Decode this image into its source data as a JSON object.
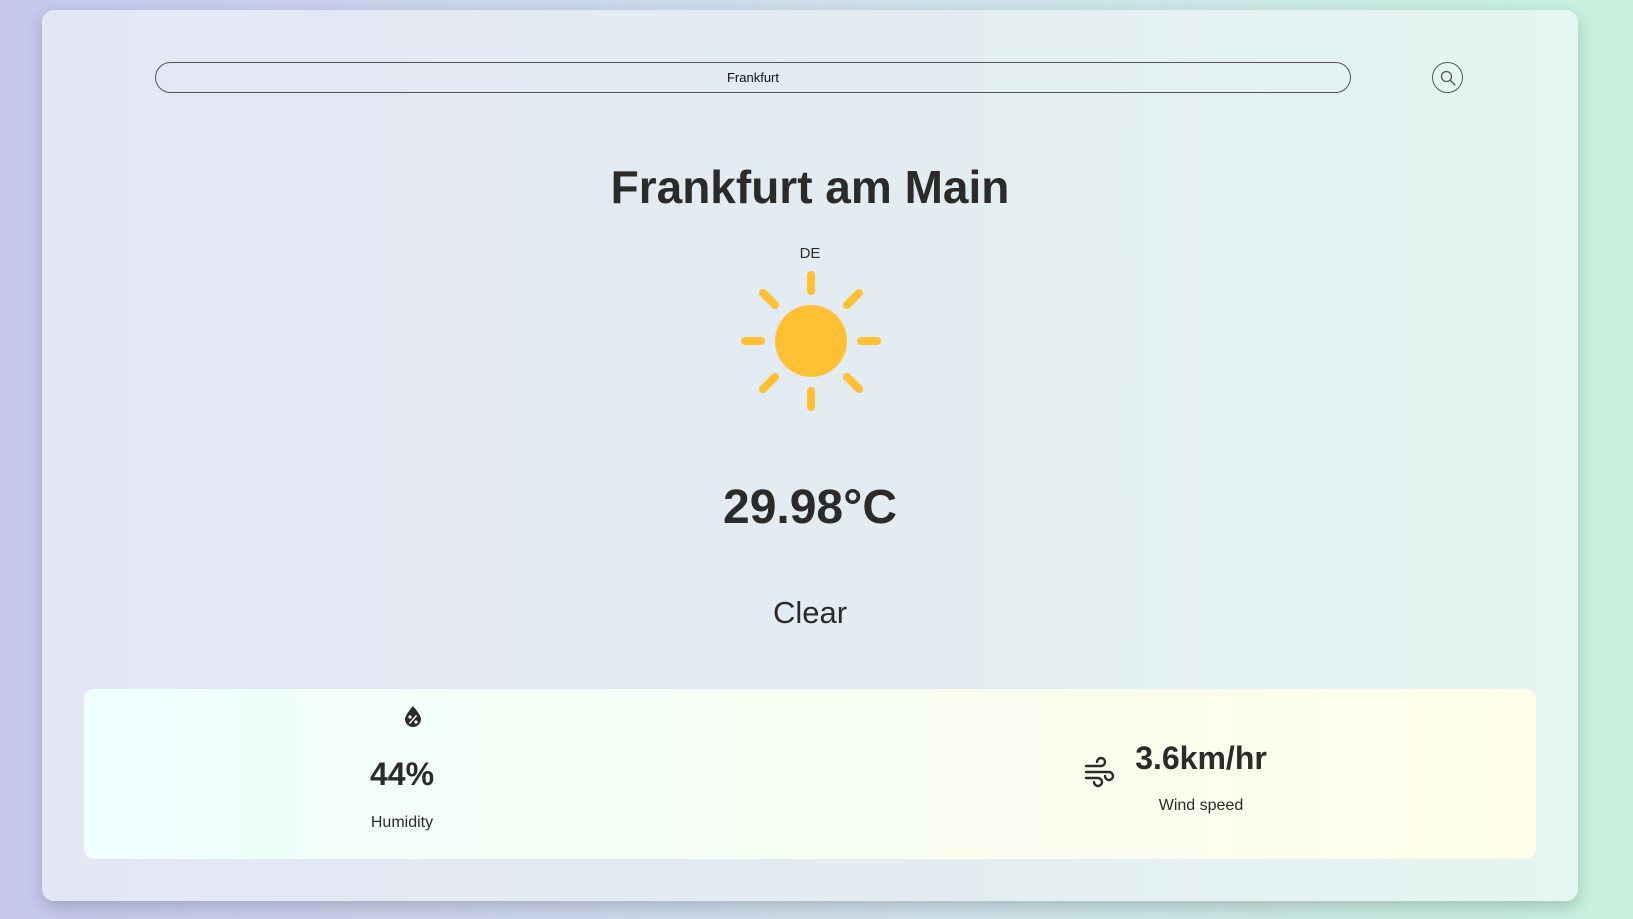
{
  "search": {
    "value": "Frankfurt",
    "icon": "search-icon"
  },
  "weather": {
    "city": "Frankfurt am Main",
    "country": "DE",
    "icon": "sun-icon",
    "icon_color": "#FFC033",
    "temperature": "29.98°C",
    "description": "Clear"
  },
  "details": {
    "humidity": {
      "icon": "humidity-icon",
      "value": "44%",
      "label": "Humidity"
    },
    "wind": {
      "icon": "wind-icon",
      "value": "3.6km/hr",
      "label": "Wind speed"
    }
  }
}
